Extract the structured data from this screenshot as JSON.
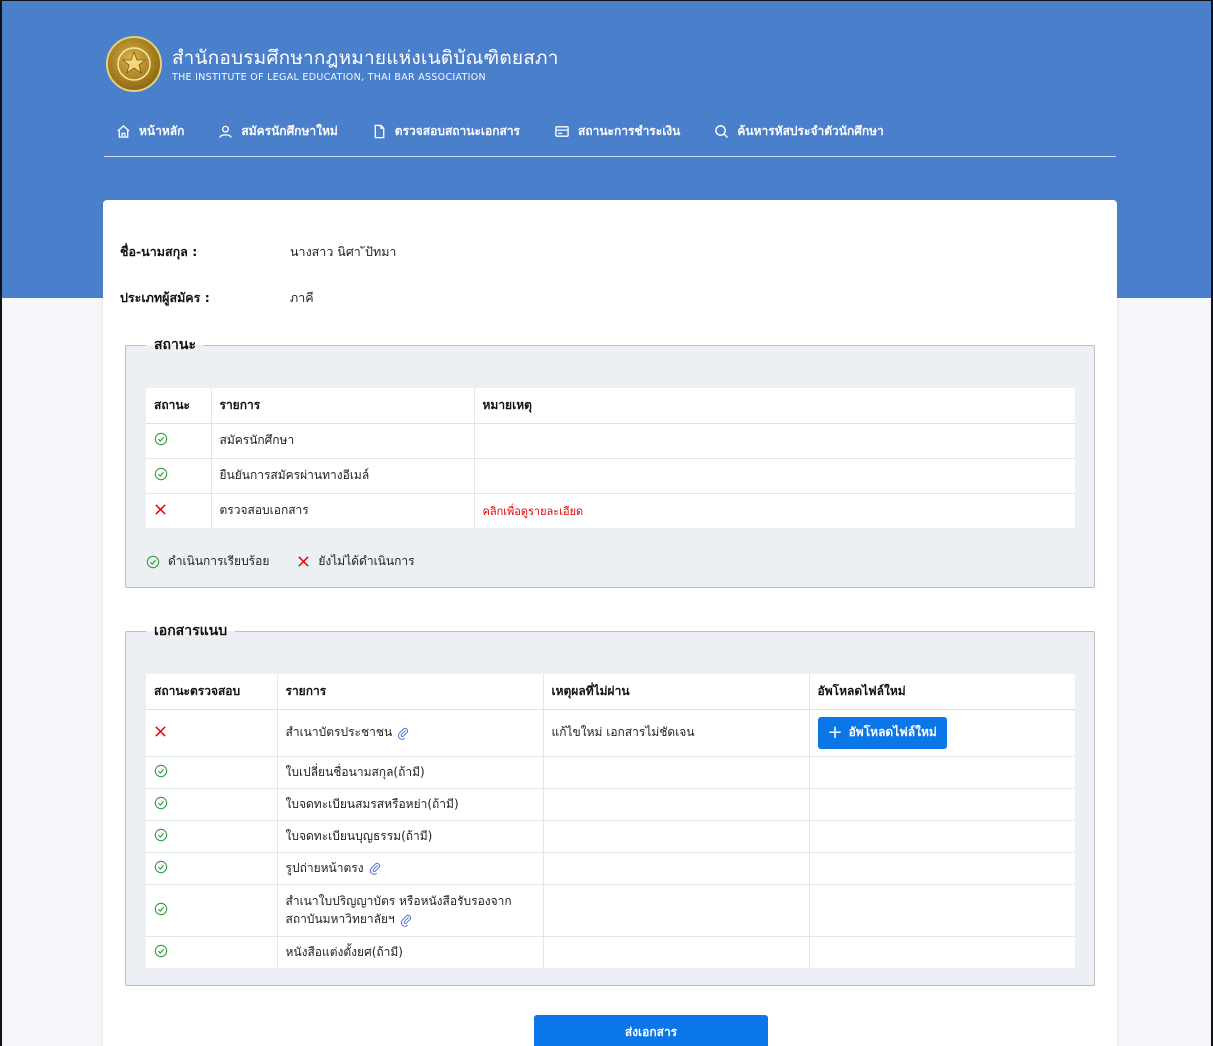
{
  "header": {
    "org_name_th": "สำนักอบรมศึกษากฎหมายแห่งเนติบัณฑิตยสภา",
    "org_name_en": "THE INSTITUTE OF LEGAL EDUCATION, THAI BAR ASSOCIATION",
    "logo_icon": "thai-bar-emblem-icon"
  },
  "nav": {
    "items": [
      {
        "label": "หน้าหลัก",
        "icon": "home-icon"
      },
      {
        "label": "สมัครนักศึกษาใหม่",
        "icon": "user-icon"
      },
      {
        "label": "ตรวจสอบสถานะเอกสาร",
        "icon": "document-icon"
      },
      {
        "label": "สถานะการชำระเงิน",
        "icon": "credit-card-icon"
      },
      {
        "label": "ค้นหารหัสประจำตัวนักศึกษา",
        "icon": "search-icon"
      }
    ]
  },
  "applicant": {
    "name_label": "ชื่อ-นามสกุล :",
    "name_value": "นางสาว นิศา ัปัทมา",
    "type_label": "ประเภทผู้สมัคร :",
    "type_value": "ภาคี"
  },
  "status": {
    "title": "สถานะ",
    "columns": [
      "สถานะ",
      "รายการ",
      "หมายเหตุ"
    ],
    "rows": [
      {
        "status": "done",
        "item": "สมัครนักศึกษา",
        "note": ""
      },
      {
        "status": "done",
        "item": "ยืนยันการสมัครผ่านทางอีเมล์",
        "note": ""
      },
      {
        "status": "pending",
        "item": "ตรวจสอบเอกสาร",
        "note": "คลิกเพื่อดูรายละเอียด"
      }
    ],
    "legend_done": "ดำเนินการเรียบร้อย",
    "legend_pending": "ยังไม่ได้ดำเนินการ"
  },
  "attachments": {
    "title": "เอกสารแนบ",
    "columns": [
      "สถานะตรวจสอบ",
      "รายการ",
      "เหตุผลที่ไม่ผ่าน",
      "อัพโหลดไฟล์ใหม่"
    ],
    "rows": [
      {
        "status": "fail",
        "item": "สำเนาบัตรประชาชน",
        "item_line2": "",
        "clip": true,
        "reason": "แก้ไขใหม่ เอกสารไม่ชัดเจน",
        "upload": true
      },
      {
        "status": "pass",
        "item": "ใบเปลี่ยนชื่อนามสกุล(ถ้ามี)",
        "item_line2": "",
        "clip": false,
        "reason": "",
        "upload": false
      },
      {
        "status": "pass",
        "item": "ใบจดทะเบียนสมรสหรือหย่า(ถ้ามี)",
        "item_line2": "",
        "clip": false,
        "reason": "",
        "upload": false
      },
      {
        "status": "pass",
        "item": "ใบจดทะเบียนบุญธรรม(ถ้ามี)",
        "item_line2": "",
        "clip": false,
        "reason": "",
        "upload": false
      },
      {
        "status": "pass",
        "item": "รูปถ่ายหน้าตรง",
        "item_line2": "",
        "clip": true,
        "reason": "",
        "upload": false
      },
      {
        "status": "pass",
        "item": "สำเนาใบปริญญาบัตร หรือหนังสือรับรองจาก",
        "item_line2": "สถาบันมหาวิทยาลัยฯ",
        "clip": true,
        "reason": "",
        "upload": false
      },
      {
        "status": "pass",
        "item": "หนังสือแต่งตั้งยศ(ถ้ามี)",
        "item_line2": "",
        "clip": false,
        "reason": "",
        "upload": false
      }
    ],
    "upload_button_label": "อัพโหลดไฟล์ใหม่"
  },
  "submit_label": "ส่งเอกสาร",
  "colors": {
    "header_bg": "#4a7fcb",
    "primary_button": "#0b76e8",
    "check_green": "#2e9e3a",
    "cross_red": "#e00000"
  }
}
